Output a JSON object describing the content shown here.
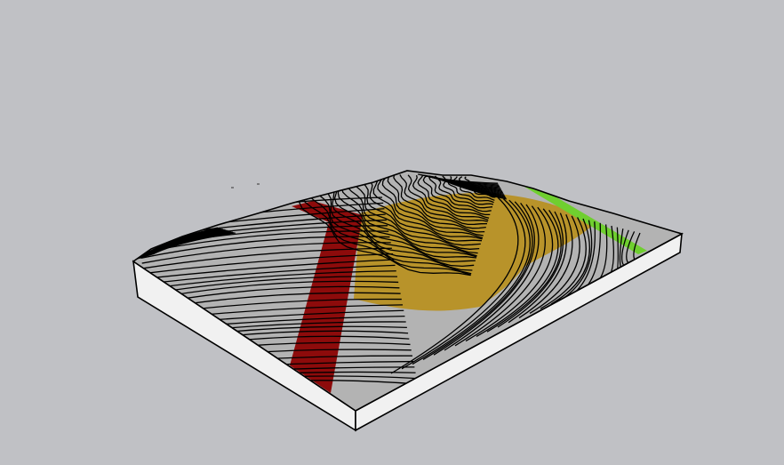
{
  "scene": {
    "background_color": "#c0c1c5",
    "model": "3d-terrain-contour-block",
    "terrain_color": "#b3b3b3",
    "contour_color": "#000000",
    "base_side_color": "#f1f1f1",
    "regions": [
      {
        "name": "red-strip",
        "color": "#8d0b0b"
      },
      {
        "name": "gold-area",
        "color": "#b8932a"
      },
      {
        "name": "green-strip",
        "color": "#6fcf2f"
      }
    ]
  }
}
